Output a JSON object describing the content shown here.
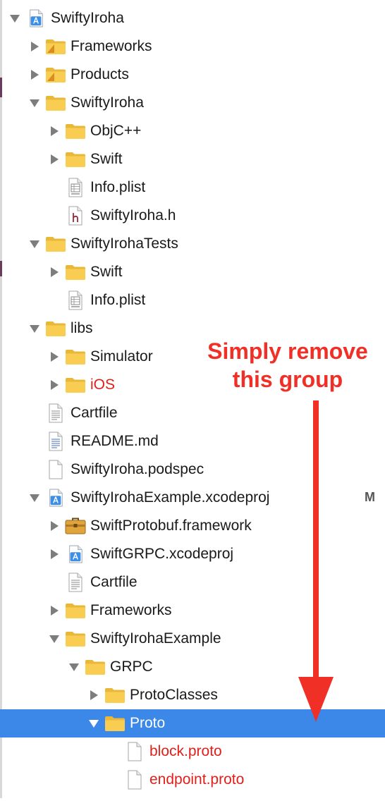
{
  "tree": {
    "root": {
      "label": "SwiftyIroha"
    },
    "frameworks": {
      "label": "Frameworks"
    },
    "products": {
      "label": "Products"
    },
    "swiftyiroha_group": {
      "label": "SwiftyIroha"
    },
    "objc": {
      "label": "ObjC++"
    },
    "swift": {
      "label": "Swift"
    },
    "infoplist": {
      "label": "Info.plist"
    },
    "header": {
      "label": "SwiftyIroha.h"
    },
    "tests": {
      "label": "SwiftyIrohaTests"
    },
    "tests_swift": {
      "label": "Swift"
    },
    "tests_infoplist": {
      "label": "Info.plist"
    },
    "libs": {
      "label": "libs"
    },
    "simulator": {
      "label": "Simulator"
    },
    "ios": {
      "label": "iOS"
    },
    "cartfile": {
      "label": "Cartfile"
    },
    "readme": {
      "label": "README.md"
    },
    "podspec": {
      "label": "SwiftyIroha.podspec"
    },
    "example_proj": {
      "label": "SwiftyIrohaExample.xcodeproj",
      "badge": "M"
    },
    "protobuf": {
      "label": "SwiftProtobuf.framework"
    },
    "grpc_proj": {
      "label": "SwiftGRPC.xcodeproj"
    },
    "example_cartfile": {
      "label": "Cartfile"
    },
    "example_frameworks": {
      "label": "Frameworks"
    },
    "example_group": {
      "label": "SwiftyIrohaExample"
    },
    "grpc": {
      "label": "GRPC"
    },
    "protoclasses": {
      "label": "ProtoClasses"
    },
    "proto": {
      "label": "Proto"
    },
    "block_proto": {
      "label": "block.proto"
    },
    "endpoint_proto": {
      "label": "endpoint.proto"
    }
  },
  "annotation": {
    "line1": "Simply remove",
    "line2": "this group"
  },
  "colors": {
    "selection": "#3b88e8",
    "annotation": "#f03027",
    "modified_text": "#e0201b",
    "folder": "#f6c74a"
  }
}
